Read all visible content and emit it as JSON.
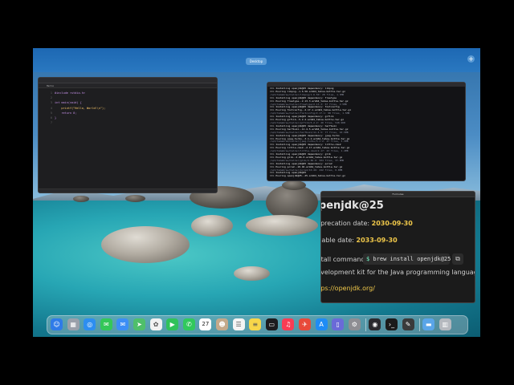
{
  "desktop": {
    "label": "Desktop",
    "add_icon": "plus-icon"
  },
  "editor": {
    "tab_label": "Hello",
    "lines": [
      {
        "n": "1",
        "text": "#include <stdio.h>"
      },
      {
        "n": "2",
        "text": ""
      },
      {
        "n": "3",
        "text": "int main(void) {"
      },
      {
        "n": "4",
        "text": "    printf(\"Hello, World!\\n\");"
      },
      {
        "n": "5",
        "text": "    return 0;"
      },
      {
        "n": "6",
        "text": "}"
      },
      {
        "n": "7",
        "text": ""
      }
    ]
  },
  "terminal": {
    "lines": [
      {
        "type": "h",
        "text": "==> Installing openjdk@25 dependency: libpng"
      },
      {
        "type": "h",
        "text": "==> Pouring libpng--1.6.50.arm64_tahoe.bottle.tar.gz"
      },
      {
        "type": "d",
        "text": "/opt/homebrew/Cellar/libpng/1.6.50: 28 files, 1.3MB"
      },
      {
        "type": "h",
        "text": "==> Installing openjdk@25 dependency: freetype"
      },
      {
        "type": "h",
        "text": "==> Pouring freetype--2.13.3.arm64_tahoe.bottle.tar.gz"
      },
      {
        "type": "d",
        "text": "/opt/homebrew/Cellar/freetype/2.13.3: 67 files, 2.5MB"
      },
      {
        "type": "h",
        "text": "==> Installing openjdk@25 dependency: fontconfig"
      },
      {
        "type": "h",
        "text": "==> Pouring fontconfig--2.17.1.arm64_tahoe.bottle.tar.gz"
      },
      {
        "type": "d",
        "text": "/opt/homebrew/Cellar/fontconfig/2.17.1: 98 files, 1.5MB"
      },
      {
        "type": "h",
        "text": "==> Installing openjdk@25 dependency: giflib"
      },
      {
        "type": "h",
        "text": "==> Pouring giflib--5.2.2.arm64_tahoe.bottle.tar.gz"
      },
      {
        "type": "d",
        "text": "/opt/homebrew/Cellar/giflib/5.2.2: 20 files, 548.9KB"
      },
      {
        "type": "h",
        "text": "==> Installing openjdk@25 dependency: harfbuzz"
      },
      {
        "type": "h",
        "text": "==> Pouring harfbuzz--11.4.5.arm64_tahoe.bottle.tar.gz"
      },
      {
        "type": "d",
        "text": "/opt/homebrew/Cellar/harfbuzz/11.4.5: 77 files, 10.5MB"
      },
      {
        "type": "h",
        "text": "==> Installing openjdk@25 dependency: jpeg-turbo"
      },
      {
        "type": "h",
        "text": "==> Pouring jpeg-turbo--3.1.2.arm64_tahoe.bottle.tar.gz"
      },
      {
        "type": "d",
        "text": "/opt/homebrew/Cellar/jpeg-turbo/3.1.2: 47 files, 3.5MB"
      },
      {
        "type": "h",
        "text": "==> Installing openjdk@25 dependency: little-cms2"
      },
      {
        "type": "h",
        "text": "==> Pouring little-cms2--2.17.arm64_tahoe.bottle.tar.gz"
      },
      {
        "type": "d",
        "text": "/opt/homebrew/Cellar/little-cms2/2.17: 23 files, 1.4MB"
      },
      {
        "type": "h",
        "text": "==> Installing openjdk@25 dependency: glib"
      },
      {
        "type": "h",
        "text": "==> Pouring glib--2.86.0.arm64_tahoe.bottle.tar.gz"
      },
      {
        "type": "d",
        "text": "/opt/homebrew/Cellar/glib/2.86.0: 504 files, 37.8MB"
      },
      {
        "type": "h",
        "text": "==> Installing openjdk@25 dependency: pcre2"
      },
      {
        "type": "h",
        "text": "==> Pouring pcre2--10.46.arm64_tahoe.bottle.tar.gz"
      },
      {
        "type": "d",
        "text": "/opt/homebrew/Cellar/pcre2/10.46: 242 files, 6.8MB"
      },
      {
        "type": "h",
        "text": "==> Installing openjdk@25"
      },
      {
        "type": "h",
        "text": "==> Pouring openjdk@25--25.arm64_tahoe.bottle.tar.gz"
      }
    ]
  },
  "formula": {
    "window_title": "Formulae",
    "title": "openjdk@25",
    "deprecation_label": "Deprecation date: ",
    "deprecation_value": "2030-09-30",
    "disable_label": "Disable date: ",
    "disable_value": "2033-09-30",
    "install_label": "Install command:",
    "install_prompt": "$",
    "install_command": " brew install openjdk@25",
    "copy_icon": "copy-icon",
    "description": "Development kit for the Java programming language",
    "homepage": "https://openjdk.org/"
  },
  "dock": {
    "date_badge": "27",
    "apps": [
      {
        "name": "finder-icon",
        "color": "#2f7be8",
        "glyph": "☺"
      },
      {
        "name": "launchpad-icon",
        "color": "#9aa0aa",
        "glyph": "▦"
      },
      {
        "name": "safari-icon",
        "color": "#2d8ef0",
        "glyph": "◎"
      },
      {
        "name": "messages-icon",
        "color": "#34c759",
        "glyph": "✉"
      },
      {
        "name": "mail-icon",
        "color": "#3c8ef5",
        "glyph": "✉"
      },
      {
        "name": "maps-icon",
        "color": "#4fbf6a",
        "glyph": "➤"
      },
      {
        "name": "photos-icon",
        "color": "#f2f2f2",
        "glyph": "✿"
      },
      {
        "name": "facetime-icon",
        "color": "#30c25a",
        "glyph": "▶"
      },
      {
        "name": "phone-icon",
        "color": "#31c95c",
        "glyph": "✆"
      },
      {
        "name": "calendar-icon",
        "color": "#ffffff",
        "glyph": ""
      },
      {
        "name": "contacts-icon",
        "color": "#c4a98a",
        "glyph": "☻"
      },
      {
        "name": "reminders-icon",
        "color": "#f4f4f4",
        "glyph": "☰"
      },
      {
        "name": "notes-icon",
        "color": "#f7d64a",
        "glyph": "≡"
      },
      {
        "name": "tv-icon",
        "color": "#1c1c1e",
        "glyph": "▭"
      },
      {
        "name": "music-icon",
        "color": "#fa3c54",
        "glyph": "♫"
      },
      {
        "name": "rocket-icon",
        "color": "#e84a3a",
        "glyph": "✈"
      },
      {
        "name": "app-store-icon",
        "color": "#1f8cf5",
        "glyph": "A"
      },
      {
        "name": "iphone-mirroring-icon",
        "color": "#6a6ad8",
        "glyph": "▯"
      },
      {
        "name": "settings-icon",
        "color": "#8e8e93",
        "glyph": "⚙"
      },
      {
        "name": "activity-icon",
        "color": "#2a2a2e",
        "glyph": "◉"
      },
      {
        "name": "terminal-icon",
        "color": "#1b1b1b",
        "glyph": "›_"
      },
      {
        "name": "script-editor-icon",
        "color": "#3a3a3a",
        "glyph": "✎"
      },
      {
        "name": "downloads-folder-icon",
        "color": "#5aa5e8",
        "glyph": "▬"
      },
      {
        "name": "trash-icon",
        "color": "#b5b9bf",
        "glyph": "▥"
      }
    ]
  }
}
